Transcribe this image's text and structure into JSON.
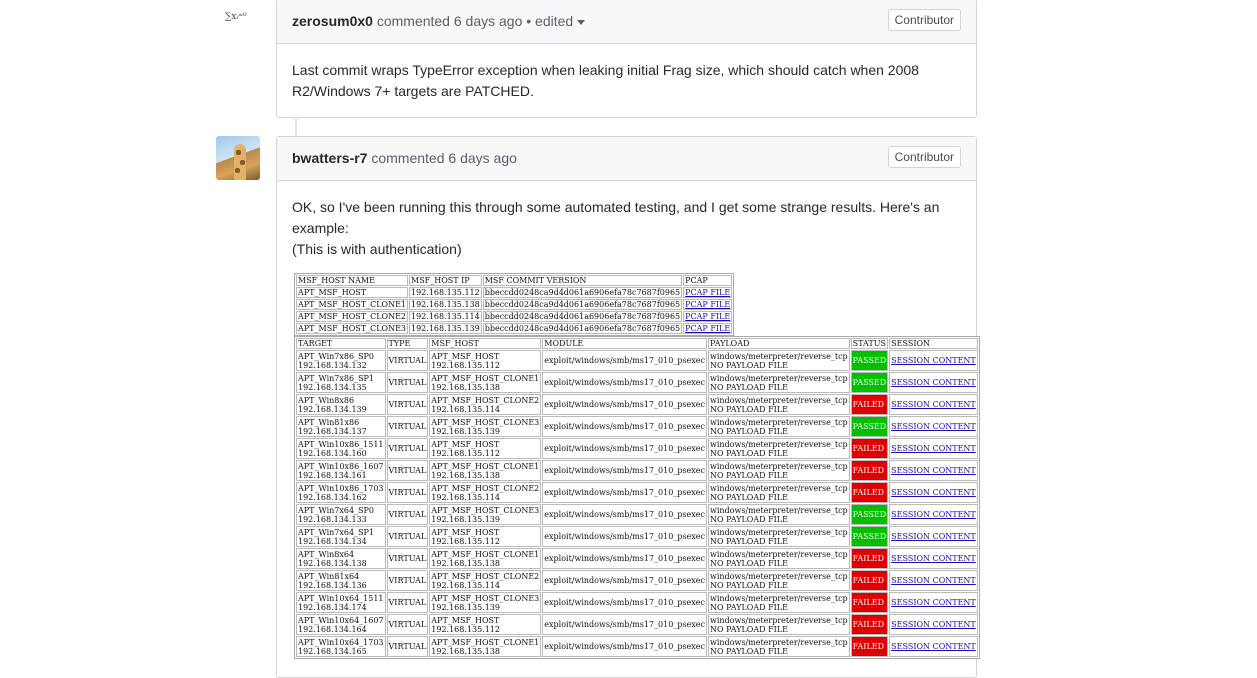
{
  "comment1": {
    "author": "zerosum0x0",
    "action": "commented",
    "time": "6 days ago",
    "edited": "• edited",
    "badge": "Contributor",
    "avatar_text": "∑xᵢ⁼⁰",
    "body": "Last commit wraps TypeError exception when leaking initial Frag size, which should catch when 2008 R2/Windows 7+ targets are PATCHED."
  },
  "comment2": {
    "author": "bwatters-r7",
    "action": "commented",
    "time": "6 days ago",
    "badge": "Contributor",
    "body_line1": "OK, so I've been running this through some automated testing, and I get some strange results. Here's an example:",
    "body_line2": "(This is with authentication)"
  },
  "hosts_table": {
    "headers": [
      "MSF_HOST NAME",
      "MSF_HOST IP",
      "MSF COMMIT VERSION",
      "PCAP"
    ],
    "rows": [
      [
        "APT_MSF_HOST",
        "192.168.135.112",
        "bbeccdd0248ca9d4d061a6906efa78c7687f0965",
        "PCAP FILE"
      ],
      [
        "APT_MSF_HOST_CLONE1",
        "192.168.135.138",
        "bbeccdd0248ca9d4d061a6906efa78c7687f0965",
        "PCAP FILE"
      ],
      [
        "APT_MSF_HOST_CLONE2",
        "192.168.135.114",
        "bbeccdd0248ca9d4d061a6906efa78c7687f0965",
        "PCAP FILE"
      ],
      [
        "APT_MSF_HOST_CLONE3",
        "192.168.135.139",
        "bbeccdd0248ca9d4d061a6906efa78c7687f0965",
        "PCAP FILE"
      ]
    ]
  },
  "results_table": {
    "headers": [
      "TARGET",
      "TYPE",
      "MSF_HOST",
      "MODULE",
      "PAYLOAD",
      "STATUS",
      "SESSION"
    ],
    "rows": [
      {
        "target": "APT_Win7x86_SP0",
        "target_ip": "192.168.134.132",
        "type": "VIRTUAL",
        "host": "APT_MSF_HOST",
        "host_ip": "192.168.135.112",
        "module": "exploit/windows/smb/ms17_010_psexec",
        "payload": "windows/meterpreter/reverse_tcp",
        "payload_file": "NO PAYLOAD FILE",
        "status": "PASSED",
        "session": "SESSION CONTENT"
      },
      {
        "target": "APT_Win7x86_SP1",
        "target_ip": "192.168.134.135",
        "type": "VIRTUAL",
        "host": "APT_MSF_HOST_CLONE1",
        "host_ip": "192.168.135.138",
        "module": "exploit/windows/smb/ms17_010_psexec",
        "payload": "windows/meterpreter/reverse_tcp",
        "payload_file": "NO PAYLOAD FILE",
        "status": "PASSED",
        "session": "SESSION CONTENT"
      },
      {
        "target": "APT_Win8x86",
        "target_ip": "192.168.134.139",
        "type": "VIRTUAL",
        "host": "APT_MSF_HOST_CLONE2",
        "host_ip": "192.168.135.114",
        "module": "exploit/windows/smb/ms17_010_psexec",
        "payload": "windows/meterpreter/reverse_tcp",
        "payload_file": "NO PAYLOAD FILE",
        "status": "FAILED",
        "session": "SESSION CONTENT"
      },
      {
        "target": "APT_Win81x86",
        "target_ip": "192.168.134.137",
        "type": "VIRTUAL",
        "host": "APT_MSF_HOST_CLONE3",
        "host_ip": "192.168.135.139",
        "module": "exploit/windows/smb/ms17_010_psexec",
        "payload": "windows/meterpreter/reverse_tcp",
        "payload_file": "NO PAYLOAD FILE",
        "status": "PASSED",
        "session": "SESSION CONTENT"
      },
      {
        "target": "APT_Win10x86_1511",
        "target_ip": "192.168.134.160",
        "type": "VIRTUAL",
        "host": "APT_MSF_HOST",
        "host_ip": "192.168.135.112",
        "module": "exploit/windows/smb/ms17_010_psexec",
        "payload": "windows/meterpreter/reverse_tcp",
        "payload_file": "NO PAYLOAD FILE",
        "status": "FAILED",
        "session": "SESSION CONTENT"
      },
      {
        "target": "APT_Win10x86_1607",
        "target_ip": "192.168.134.161",
        "type": "VIRTUAL",
        "host": "APT_MSF_HOST_CLONE1",
        "host_ip": "192.168.135.138",
        "module": "exploit/windows/smb/ms17_010_psexec",
        "payload": "windows/meterpreter/reverse_tcp",
        "payload_file": "NO PAYLOAD FILE",
        "status": "FAILED",
        "session": "SESSION CONTENT"
      },
      {
        "target": "APT_Win10x86_1703",
        "target_ip": "192.168.134.162",
        "type": "VIRTUAL",
        "host": "APT_MSF_HOST_CLONE2",
        "host_ip": "192.168.135.114",
        "module": "exploit/windows/smb/ms17_010_psexec",
        "payload": "windows/meterpreter/reverse_tcp",
        "payload_file": "NO PAYLOAD FILE",
        "status": "FAILED",
        "session": "SESSION CONTENT"
      },
      {
        "target": "APT_Win7x64_SP0",
        "target_ip": "192.168.134.133",
        "type": "VIRTUAL",
        "host": "APT_MSF_HOST_CLONE3",
        "host_ip": "192.168.135.139",
        "module": "exploit/windows/smb/ms17_010_psexec",
        "payload": "windows/meterpreter/reverse_tcp",
        "payload_file": "NO PAYLOAD FILE",
        "status": "PASSED",
        "session": "SESSION CONTENT"
      },
      {
        "target": "APT_Win7x64_SP1",
        "target_ip": "192.168.134.134",
        "type": "VIRTUAL",
        "host": "APT_MSF_HOST",
        "host_ip": "192.168.135.112",
        "module": "exploit/windows/smb/ms17_010_psexec",
        "payload": "windows/meterpreter/reverse_tcp",
        "payload_file": "NO PAYLOAD FILE",
        "status": "PASSED",
        "session": "SESSION CONTENT"
      },
      {
        "target": "APT_Win8x64",
        "target_ip": "192.168.134.138",
        "type": "VIRTUAL",
        "host": "APT_MSF_HOST_CLONE1",
        "host_ip": "192.168.135.138",
        "module": "exploit/windows/smb/ms17_010_psexec",
        "payload": "windows/meterpreter/reverse_tcp",
        "payload_file": "NO PAYLOAD FILE",
        "status": "FAILED",
        "session": "SESSION CONTENT"
      },
      {
        "target": "APT_Win81x64",
        "target_ip": "192.168.134.136",
        "type": "VIRTUAL",
        "host": "APT_MSF_HOST_CLONE2",
        "host_ip": "192.168.135.114",
        "module": "exploit/windows/smb/ms17_010_psexec",
        "payload": "windows/meterpreter/reverse_tcp",
        "payload_file": "NO PAYLOAD FILE",
        "status": "FAILED",
        "session": "SESSION CONTENT"
      },
      {
        "target": "APT_Win10x64_1511",
        "target_ip": "192.168.134.174",
        "type": "VIRTUAL",
        "host": "APT_MSF_HOST_CLONE3",
        "host_ip": "192.168.135.139",
        "module": "exploit/windows/smb/ms17_010_psexec",
        "payload": "windows/meterpreter/reverse_tcp",
        "payload_file": "NO PAYLOAD FILE",
        "status": "FAILED",
        "session": "SESSION CONTENT"
      },
      {
        "target": "APT_Win10x64_1607",
        "target_ip": "192.168.134.164",
        "type": "VIRTUAL",
        "host": "APT_MSF_HOST",
        "host_ip": "192.168.135.112",
        "module": "exploit/windows/smb/ms17_010_psexec",
        "payload": "windows/meterpreter/reverse_tcp",
        "payload_file": "NO PAYLOAD FILE",
        "status": "FAILED",
        "session": "SESSION CONTENT"
      },
      {
        "target": "APT_Win10x64_1703",
        "target_ip": "192.168.134.165",
        "type": "VIRTUAL",
        "host": "APT_MSF_HOST_CLONE1",
        "host_ip": "192.168.135.138",
        "module": "exploit/windows/smb/ms17_010_psexec",
        "payload": "windows/meterpreter/reverse_tcp",
        "payload_file": "NO PAYLOAD FILE",
        "status": "FAILED",
        "session": "SESSION CONTENT"
      }
    ]
  },
  "colors": {
    "passed": "#00c000",
    "failed": "#e00000",
    "link": "#1a0dab"
  }
}
